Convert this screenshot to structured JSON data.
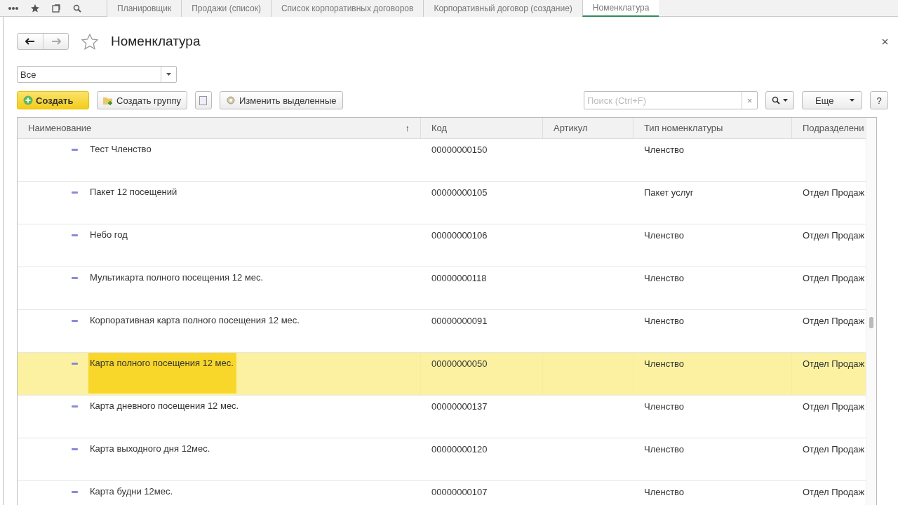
{
  "tabs": [
    {
      "label": "Планировщик",
      "selected": false
    },
    {
      "label": "Продажи (список)",
      "selected": false
    },
    {
      "label": "Список корпоративных договоров",
      "selected": false
    },
    {
      "label": "Корпоративный договор (создание)",
      "selected": false
    },
    {
      "label": "Номенклатура",
      "selected": true
    }
  ],
  "window": {
    "title": "Номенклатура"
  },
  "filter": {
    "value": "Все"
  },
  "toolbar": {
    "create": "Создать",
    "create_group": "Создать группу",
    "edit_selected": "Изменить выделенные",
    "more": "Еще",
    "help": "?"
  },
  "search": {
    "placeholder": "Поиск (Ctrl+F)",
    "clear": "×"
  },
  "table": {
    "columns": [
      {
        "label": "Наименование",
        "sort": "↑"
      },
      {
        "label": "Код"
      },
      {
        "label": "Артикул"
      },
      {
        "label": "Тип номенклатуры"
      },
      {
        "label": "Подразделени"
      }
    ],
    "rows": [
      {
        "name": "Тест Членство",
        "code": "00000000150",
        "type": "Членство",
        "dept": "",
        "selected": false
      },
      {
        "name": "Пакет 12 посещений",
        "code": "00000000105",
        "type": "Пакет услуг",
        "dept": "Отдел Продаж",
        "selected": false
      },
      {
        "name": "Небо год",
        "code": "00000000106",
        "type": "Членство",
        "dept": "Отдел Продаж",
        "selected": false
      },
      {
        "name": "Мультикарта полного посещения 12 мес.",
        "code": "00000000118",
        "type": "Членство",
        "dept": "Отдел Продаж",
        "selected": false
      },
      {
        "name": "Корпоративная карта полного посещения 12 мес.",
        "code": "00000000091",
        "type": "Членство",
        "dept": "Отдел Продаж",
        "selected": false
      },
      {
        "name": "Карта полного посещения 12 мес.",
        "code": "00000000050",
        "type": "Членство",
        "dept": "Отдел Продаж",
        "selected": true
      },
      {
        "name": "Карта дневного посещения 12 мес.",
        "code": "00000000137",
        "type": "Членство",
        "dept": "Отдел Продаж",
        "selected": false
      },
      {
        "name": "Карта выходного дня 12мес.",
        "code": "00000000120",
        "type": "Членство",
        "dept": "Отдел Продаж",
        "selected": false
      },
      {
        "name": "Карта будни 12мес.",
        "code": "00000000107",
        "type": "Членство",
        "dept": "Отдел Продаж",
        "selected": false
      }
    ]
  }
}
